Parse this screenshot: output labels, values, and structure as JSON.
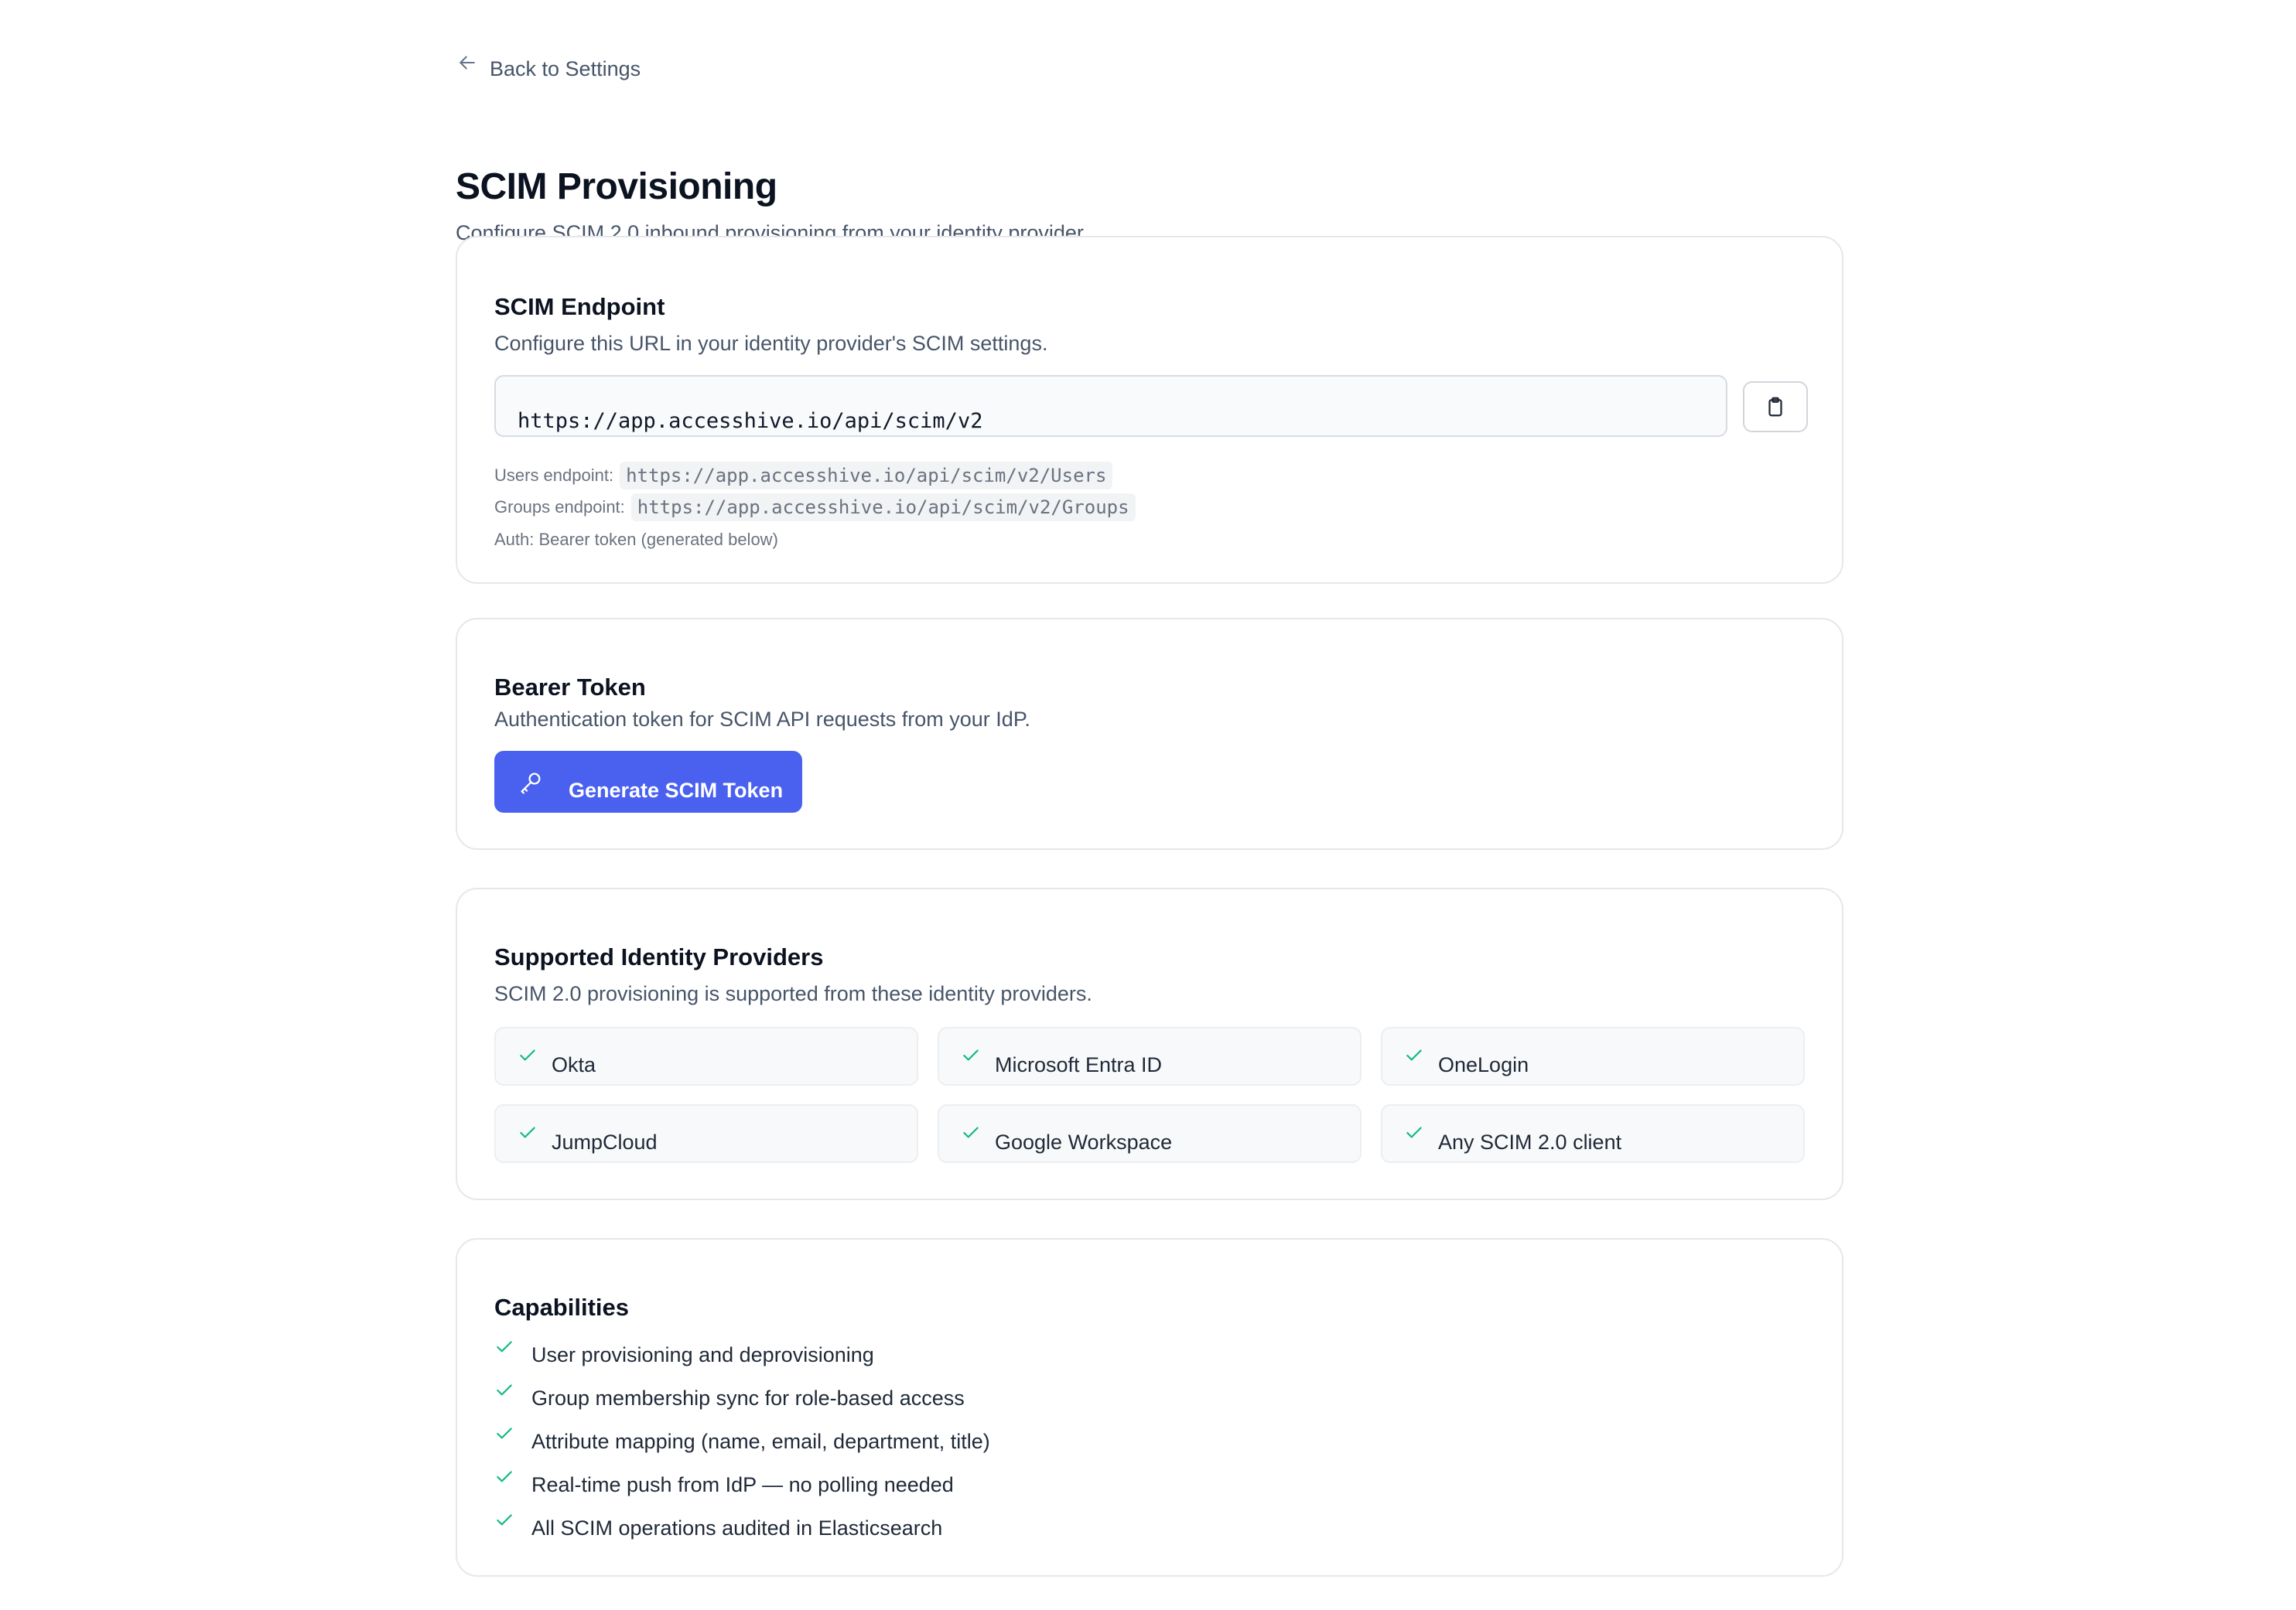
{
  "nav": {
    "back_label": "Back to Settings"
  },
  "header": {
    "title": "SCIM Provisioning",
    "subtitle": "Configure SCIM 2.0 inbound provisioning from your identity provider"
  },
  "endpoint": {
    "title": "SCIM Endpoint",
    "description": "Configure this URL in your identity provider's SCIM settings.",
    "url": "https://app.accesshive.io/api/scim/v2",
    "users_label": "Users endpoint:",
    "users_url": "https://app.accesshive.io/api/scim/v2/Users",
    "groups_label": "Groups endpoint:",
    "groups_url": "https://app.accesshive.io/api/scim/v2/Groups",
    "auth_note": "Auth: Bearer token (generated below)"
  },
  "token": {
    "title": "Bearer Token",
    "description": "Authentication token for SCIM API requests from your IdP.",
    "button_label": "Generate SCIM Token"
  },
  "providers": {
    "title": "Supported Identity Providers",
    "description": "SCIM 2.0 provisioning is supported from these identity providers.",
    "items": [
      "Okta",
      "Microsoft Entra ID",
      "OneLogin",
      "JumpCloud",
      "Google Workspace",
      "Any SCIM 2.0 client"
    ]
  },
  "capabilities": {
    "title": "Capabilities",
    "items": [
      "User provisioning and deprovisioning",
      "Group membership sync for role-based access",
      "Attribute mapping (name, email, department, title)",
      "Real-time push from IdP — no polling needed",
      "All SCIM operations audited in Elasticsearch"
    ]
  },
  "colors": {
    "accent": "#4a61f0",
    "check": "#10b981"
  },
  "icons": {
    "back": "arrow-left-icon",
    "copy": "clipboard-icon",
    "key": "key-icon",
    "check": "check-icon"
  }
}
